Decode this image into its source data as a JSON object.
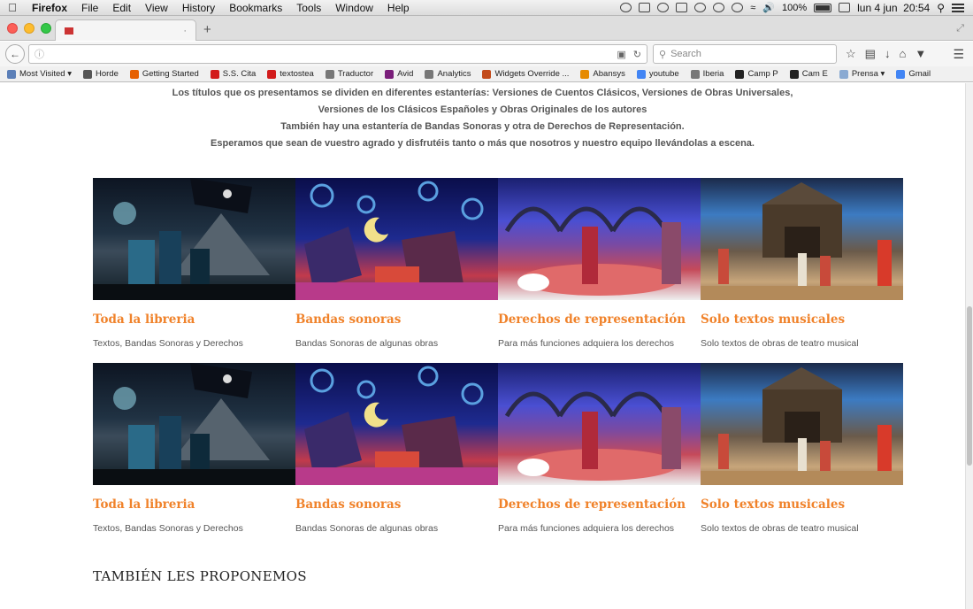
{
  "menubar": {
    "app": "Firefox",
    "items": [
      "File",
      "Edit",
      "View",
      "History",
      "Bookmarks",
      "Tools",
      "Window",
      "Help"
    ],
    "battery": "100%",
    "datetime": "lun 4 jun  20:54"
  },
  "browser": {
    "search_placeholder": "Search",
    "bookmarks": [
      {
        "label": "Most Visited ▾",
        "color": "#5b7fb8"
      },
      {
        "label": "Horde",
        "color": "#555555"
      },
      {
        "label": "Getting Started",
        "color": "#e66000"
      },
      {
        "label": "S.S. Cita",
        "color": "#d21c1c"
      },
      {
        "label": "textostea",
        "color": "#d21c1c"
      },
      {
        "label": "Traductor",
        "color": "#777777"
      },
      {
        "label": "Avid",
        "color": "#7a1e7a"
      },
      {
        "label": "Analytics",
        "color": "#777777"
      },
      {
        "label": "Widgets Override ...",
        "color": "#c24a1a"
      },
      {
        "label": "Abansys",
        "color": "#e68a00"
      },
      {
        "label": "youtube",
        "color": "#4285f4"
      },
      {
        "label": "Iberia",
        "color": "#777777"
      },
      {
        "label": "Camp P",
        "color": "#222222"
      },
      {
        "label": "Cam E",
        "color": "#222222"
      },
      {
        "label": "Prensa ▾",
        "color": "#8aaad2"
      },
      {
        "label": "Gmail",
        "color": "#4285f4"
      }
    ]
  },
  "intro": {
    "lines": [
      "Los títulos que os presentamos se dividen en diferentes estanterías: Versiones de Cuentos Clásicos, Versiones de Obras Universales,",
      "Versiones de los Clásicos Españoles y Obras Originales de los autores",
      "También hay una estantería de Bandas Sonoras y otra de Derechos de Representación.",
      "Esperamos que sean de vuestro agrado y disfrutéis tanto o más que nosotros y nuestro equipo llevándolas a escena."
    ]
  },
  "rows": [
    {
      "cards": [
        {
          "title": "Toda la libreria",
          "desc": "Textos, Bandas Sonoras y Derechos"
        },
        {
          "title": "Bandas sonoras",
          "desc": "Bandas Sonoras de algunas obras"
        },
        {
          "title": "Derechos de representación",
          "desc": "Para más funciones adquiera los derechos"
        },
        {
          "title": "Solo textos musicales",
          "desc": "Solo textos de obras de teatro musical"
        }
      ]
    },
    {
      "cards": [
        {
          "title": "Toda la libreria",
          "desc": "Textos, Bandas Sonoras y Derechos"
        },
        {
          "title": "Bandas sonoras",
          "desc": "Bandas Sonoras de algunas obras"
        },
        {
          "title": "Derechos de representación",
          "desc": "Para más funciones adquiera los derechos"
        },
        {
          "title": "Solo textos musicales",
          "desc": "Solo textos de obras de teatro musical"
        }
      ]
    }
  ],
  "section_title": "TAMBIÉN LES PROPONEMOS",
  "colors": {
    "accent": "#f0822a"
  }
}
